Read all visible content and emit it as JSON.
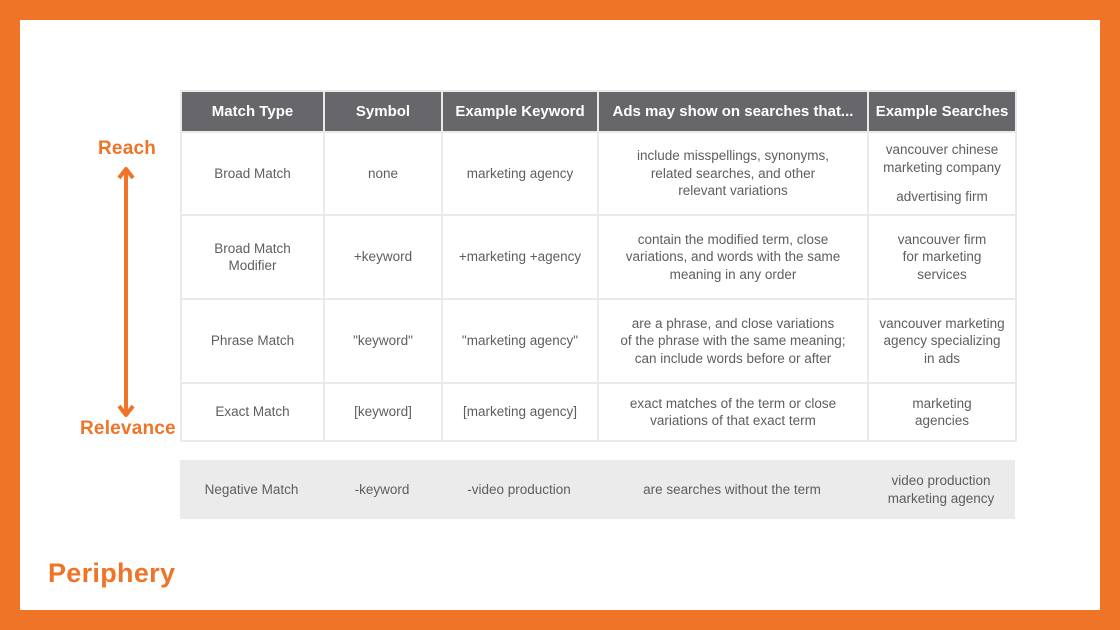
{
  "scale": {
    "top_label": "Reach",
    "bottom_label": "Relevance",
    "accent_color": "#f07427"
  },
  "table": {
    "headers": [
      "Match Type",
      "Symbol",
      "Example Keyword",
      "Ads may show on searches that...",
      "Example Searches"
    ],
    "rows": [
      {
        "match_type": "Broad Match",
        "symbol": "none",
        "example_keyword": "marketing agency",
        "ads_show": "include misspellings, synonyms,\nrelated searches, and other\nrelevant variations",
        "example_searches": "vancouver chinese\nmarketing company",
        "example_searches_extra": "advertising firm"
      },
      {
        "match_type": "Broad Match\nModifier",
        "symbol": "+keyword",
        "example_keyword": "+marketing +agency",
        "ads_show": "contain the modified term, close\nvariations, and words with the same\nmeaning in any order",
        "example_searches": "vancouver firm\nfor marketing\nservices"
      },
      {
        "match_type": "Phrase Match",
        "symbol": "\"keyword\"",
        "example_keyword": "\"marketing agency\"",
        "ads_show": "are a phrase, and close variations\nof the phrase with the same meaning;\ncan include words before or after",
        "example_searches": "vancouver marketing\nagency specializing\nin ads"
      },
      {
        "match_type": "Exact Match",
        "symbol": "[keyword]",
        "example_keyword": "[marketing agency]",
        "ads_show": "exact matches of the term or close\nvariations of that exact term",
        "example_searches": "marketing\nagencies"
      }
    ],
    "negative_row": {
      "match_type": "Negative Match",
      "symbol": "-keyword",
      "example_keyword": "-video production",
      "ads_show": "are searches without the term",
      "example_searches": "video production\nmarketing agency"
    }
  },
  "brand": {
    "logo_text": "Periphery"
  }
}
